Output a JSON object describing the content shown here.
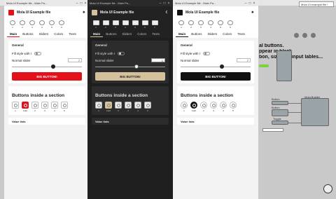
{
  "background": {
    "search_box": "Mola UI example file !",
    "canvas_text": [
      "al buttons.",
      "ppear in black",
      "bon, size and input lables..."
    ],
    "node_labels": [
      "Button",
      "Button",
      "Toggle",
      "Mola Builder"
    ]
  },
  "windows": [
    {
      "titlebar": "Mola UI Example file - Main Pa...",
      "app_title": "Mola UI Example file",
      "theme_icon": "sun-icon",
      "accent": "#e3101a",
      "radios": [
        "1",
        "2",
        "3",
        "4",
        "5",
        "6"
      ],
      "tabs": [
        "Main",
        "Buttons",
        "Sliders",
        "Colors",
        "Texts"
      ],
      "general_title": "General",
      "fill_style_label": "Fill style with I",
      "normal_slider_label": "Normal slider",
      "normal_slider_value": "7",
      "slider_level": 0.6,
      "big_button": "BIG BUTTON!",
      "buttons_section_title": "Buttons inside a section",
      "buttons": [
        "1",
        "bold",
        "2",
        "3",
        "4",
        "5"
      ],
      "value_lists": "Value lists"
    },
    {
      "titlebar": "Mola UI Example file - Main Pa...",
      "app_title": "Mola UI Example file",
      "theme_icon": "moon-icon",
      "accent": "#d4c09a",
      "radios": [
        "1",
        "2",
        "3",
        "4",
        "5",
        "6",
        "7"
      ],
      "tabs": [
        "Main",
        "Buttons",
        "Sliders",
        "Colors",
        "Texts"
      ],
      "general_title": "General",
      "fill_style_label": "Fill style with I",
      "normal_slider_label": "Normal slider",
      "normal_slider_value": "1",
      "slider_level": 0.6,
      "big_button": "BIG BUTTON!",
      "buttons_section_title": "Buttons inside a section",
      "buttons": [
        "1",
        "bold",
        "2",
        "3",
        "4",
        "5"
      ],
      "value_lists": "Value lists"
    },
    {
      "titlebar": "Mola UI Example file - Main Pa...",
      "app_title": "Mola UI Example file",
      "theme_icon": "sun-icon",
      "accent": "#111111",
      "radios": [
        "1",
        "2",
        "3",
        "4",
        "5",
        "6"
      ],
      "tabs": [
        "Main",
        "Buttons",
        "Sliders",
        "Colors",
        "Texts"
      ],
      "general_title": "General",
      "fill_style_label": "Fill style with I",
      "normal_slider_label": "Normal slider",
      "normal_slider_value": "7",
      "slider_level": 0.6,
      "big_button": "BIG BUTTON!",
      "buttons_section_title": "Buttons inside a section",
      "buttons": [
        "1",
        "bold",
        "2",
        "3",
        "4",
        "5"
      ],
      "value_lists": "Value lists"
    }
  ]
}
